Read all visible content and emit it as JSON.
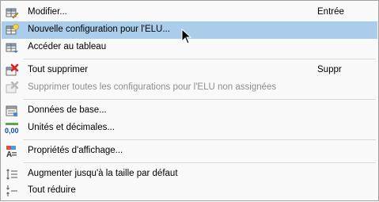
{
  "menu": {
    "items": [
      {
        "label": "Modifier...",
        "shortcut": "Entrée",
        "icon": "table-edit-icon"
      },
      {
        "label": "Nouvelle configuration pour l'ELU...",
        "shortcut": "",
        "icon": "table-new-icon",
        "highlighted": true
      },
      {
        "label": "Accéder au tableau",
        "shortcut": "",
        "icon": "table-goto-icon"
      },
      {
        "label": "Tout supprimer",
        "shortcut": "Suppr",
        "icon": "delete-all-icon"
      },
      {
        "label": "Supprimer toutes les configurations pour l'ELU non assignées",
        "shortcut": "",
        "icon": "delete-unassigned-icon",
        "disabled": true
      },
      {
        "label": "Données de base...",
        "shortcut": "",
        "icon": "base-data-icon"
      },
      {
        "label": "Unités et décimales...",
        "shortcut": "",
        "icon": "units-decimals-icon",
        "icon_text": "0,00"
      },
      {
        "label": "Propriétés d'affichage...",
        "shortcut": "",
        "icon": "display-properties-icon"
      },
      {
        "label": "Augmenter jusqu'à la taille par défaut",
        "shortcut": "",
        "icon": "expand-default-icon"
      },
      {
        "label": "Tout réduire",
        "shortcut": "",
        "icon": "collapse-all-icon"
      }
    ]
  },
  "colors": {
    "highlight": "#a9cdea",
    "disabled_text": "#8d8d8d",
    "delete_red": "#e02020"
  }
}
